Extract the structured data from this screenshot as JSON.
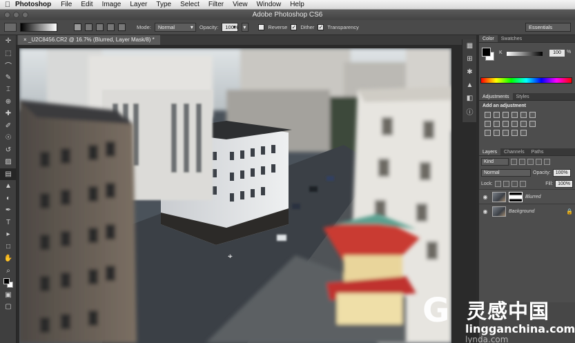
{
  "menubar": {
    "apple": "",
    "app": "Photoshop",
    "items": [
      "File",
      "Edit",
      "Image",
      "Layer",
      "Type",
      "Select",
      "Filter",
      "View",
      "Window",
      "Help"
    ]
  },
  "titlebar": {
    "title": "Adobe Photoshop CS6"
  },
  "options": {
    "mode_label": "Mode:",
    "mode_value": "Normal",
    "opacity_label": "Opacity:",
    "opacity_value": "100%",
    "reverse_label": "Reverse",
    "dither_label": "Dither",
    "transparency_label": "Transparency",
    "workspace": "Essentials",
    "reverse_checked": false,
    "dither_checked": true,
    "transparency_checked": true
  },
  "document": {
    "tab_title": "_U2C8456.CR2 @ 16.7% (Blurred, Layer Mask/8) *"
  },
  "tools": [
    "move-tool",
    "marquee-tool",
    "lasso-tool",
    "quick-select-tool",
    "crop-tool",
    "eyedropper-tool",
    "spot-heal-tool",
    "brush-tool",
    "clone-stamp-tool",
    "history-brush-tool",
    "eraser-tool",
    "gradient-tool",
    "blur-tool",
    "dodge-tool",
    "pen-tool",
    "type-tool",
    "path-select-tool",
    "shape-tool",
    "hand-tool",
    "zoom-tool",
    "color-swatches",
    "quick-mask",
    "screen-mode"
  ],
  "tool_glyphs": [
    "✛",
    "⬚",
    "⌒",
    "✎",
    "⌶",
    "⊕",
    "✚",
    "✐",
    "☉",
    "↺",
    "▨",
    "▤",
    "▲",
    "◐",
    "✒",
    "T",
    "▸",
    "□",
    "✋",
    "⌕",
    "",
    "▣",
    "▢"
  ],
  "panels": {
    "color_tabs": [
      "Color",
      "Swatches"
    ],
    "k_label": "K",
    "k_value": "100",
    "k_unit": "%",
    "adjustments_tabs": [
      "Adjustments",
      "Styles"
    ],
    "adjustments_title": "Add an adjustment",
    "layers_tabs": [
      "Layers",
      "Channels",
      "Paths"
    ],
    "kind_label": "Kind",
    "blend_mode": "Normal",
    "opacity_label": "Opacity:",
    "opacity_value": "100%",
    "lock_label": "Lock:",
    "fill_label": "Fill:",
    "fill_value": "100%",
    "layers": [
      {
        "name": "Blurred",
        "selected": true,
        "has_mask": true
      },
      {
        "name": "Background",
        "selected": false,
        "has_mask": false
      }
    ]
  },
  "watermark": {
    "cn_text": "灵感中国",
    "url": "lingganchina.com",
    "url2": "lynda.com"
  },
  "colors": {
    "foreground": "#000000",
    "background": "#ffffff"
  }
}
